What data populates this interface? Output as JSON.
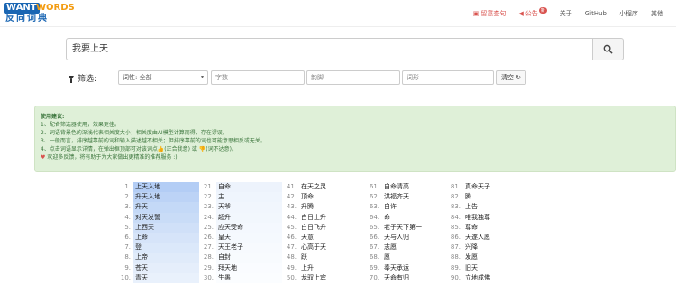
{
  "logo": {
    "want": "WANT",
    "words": "WORDS",
    "cn": "反向词典"
  },
  "nav": {
    "feedback": "留意查句",
    "notice": "公告",
    "notice_badge": "新",
    "about": "关于",
    "github": "GitHub",
    "miniprogram": "小程序",
    "other": "其他"
  },
  "search": {
    "value": "我要上天"
  },
  "filter": {
    "label": "筛选:",
    "pos": "词性: 全部",
    "count_placeholder": "字数",
    "rhyme_placeholder": "韵脚",
    "shape_placeholder": "词形",
    "clear": "清空"
  },
  "tips": {
    "title": "使用建议:",
    "items": [
      "1、配合筛选器使用，效果更佳。",
      "2、词语背景色的深浅代表相关度大小；相关度由AI模型计算而得，存在谬误。",
      "3、一般而言，排序越靠前的词和输入描述越不相关；但排序靠前的词也可能意思相反或无关。",
      "4、点击词语显示详情，在弹出框顶部可对该词点👍(正合我意) 或 👎(词不达意)。"
    ],
    "footer": "欢迎多反馈，将有助于为大家做出更精准的推荐服务 :)"
  },
  "results": [
    {
      "n": "1.",
      "w": "上天入地"
    },
    {
      "n": "2.",
      "w": "升天入地"
    },
    {
      "n": "3.",
      "w": "升天"
    },
    {
      "n": "4.",
      "w": "对天发誓"
    },
    {
      "n": "5.",
      "w": "上西天"
    },
    {
      "n": "6.",
      "w": "上命"
    },
    {
      "n": "7.",
      "w": "登"
    },
    {
      "n": "8.",
      "w": "上帝"
    },
    {
      "n": "9.",
      "w": "苍天"
    },
    {
      "n": "10.",
      "w": "青天"
    },
    {
      "n": "21.",
      "w": "自命"
    },
    {
      "n": "22.",
      "w": "主"
    },
    {
      "n": "23.",
      "w": "天爷"
    },
    {
      "n": "24.",
      "w": "超升"
    },
    {
      "n": "25.",
      "w": "应天受命"
    },
    {
      "n": "26.",
      "w": "皇天"
    },
    {
      "n": "27.",
      "w": "天王老子"
    },
    {
      "n": "28.",
      "w": "自封"
    },
    {
      "n": "29.",
      "w": "拜天地"
    },
    {
      "n": "30.",
      "w": "生愚"
    },
    {
      "n": "41.",
      "w": "在天之灵"
    },
    {
      "n": "42.",
      "w": "顶命"
    },
    {
      "n": "43.",
      "w": "升腾"
    },
    {
      "n": "44.",
      "w": "白日上升"
    },
    {
      "n": "45.",
      "w": "白日飞升"
    },
    {
      "n": "46.",
      "w": "天意"
    },
    {
      "n": "47.",
      "w": "心高于天"
    },
    {
      "n": "48.",
      "w": "跃"
    },
    {
      "n": "49.",
      "w": "上升"
    },
    {
      "n": "50.",
      "w": "龙驭上宾"
    },
    {
      "n": "61.",
      "w": "自命清高"
    },
    {
      "n": "62.",
      "w": "洪福齐天"
    },
    {
      "n": "63.",
      "w": "自许"
    },
    {
      "n": "64.",
      "w": "命"
    },
    {
      "n": "65.",
      "w": "老子天下第一"
    },
    {
      "n": "66.",
      "w": "天与人归"
    },
    {
      "n": "67.",
      "w": "志愿"
    },
    {
      "n": "68.",
      "w": "愿"
    },
    {
      "n": "69.",
      "w": "奉天承运"
    },
    {
      "n": "70.",
      "w": "天命有归"
    },
    {
      "n": "81.",
      "w": "真命天子"
    },
    {
      "n": "82.",
      "w": "腾"
    },
    {
      "n": "83.",
      "w": "上告"
    },
    {
      "n": "84.",
      "w": "唯我独尊"
    },
    {
      "n": "85.",
      "w": "尊命"
    },
    {
      "n": "86.",
      "w": "天遂人愿"
    },
    {
      "n": "87.",
      "w": "兴降"
    },
    {
      "n": "88.",
      "w": "发愿"
    },
    {
      "n": "89.",
      "w": "旧天"
    },
    {
      "n": "90.",
      "w": "立地成佛"
    }
  ]
}
